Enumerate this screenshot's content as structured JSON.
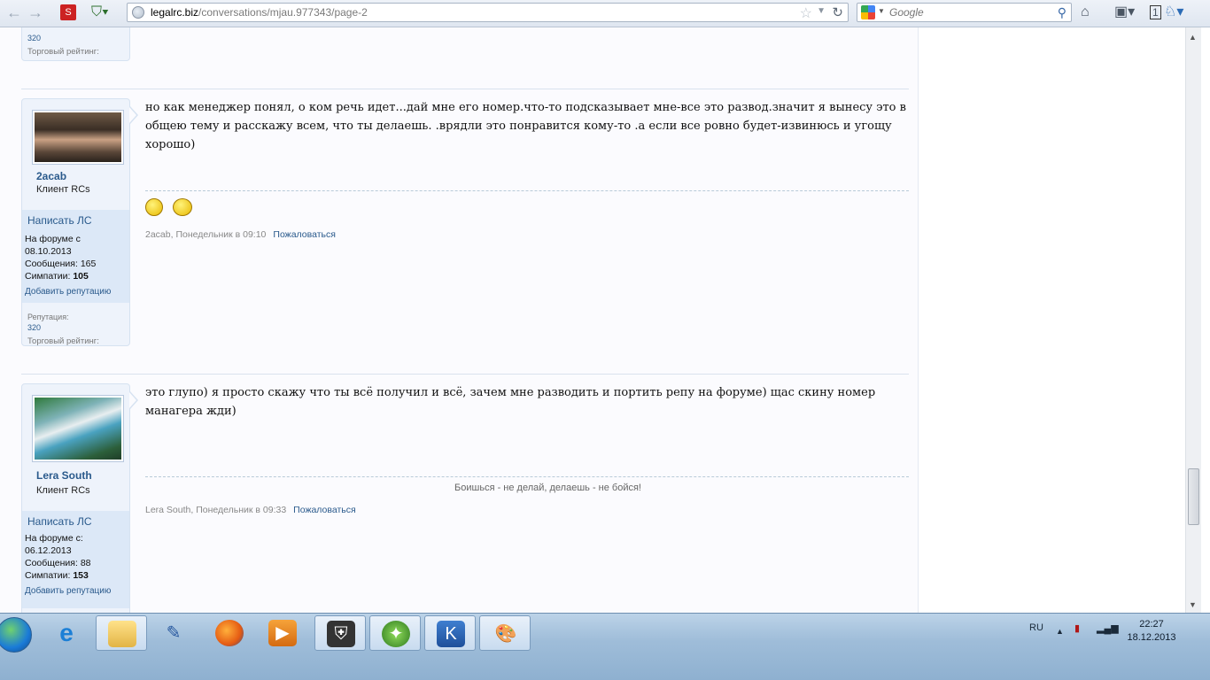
{
  "browser": {
    "url_host": "legalrc.biz",
    "url_path": "/conversations/mjau.977343/page-2",
    "search_placeholder": "Google",
    "tab_counter": "1"
  },
  "post_prev": {
    "rep_value": "320",
    "trade_label": "Торговый рейтинг:"
  },
  "posts": [
    {
      "username": "2acab",
      "user_title": "Клиент RCs",
      "pm_label": "Написать ЛС",
      "joined_label": "На форуме с",
      "joined_date": "08.10.2013",
      "messages_label": "Сообщения:",
      "messages": "165",
      "likes_label": "Симпатии:",
      "likes": "105",
      "add_rep": "Добавить репутацию",
      "rep_label": "Репутация:",
      "rep_value": "320",
      "trade_label": "Торговый рейтинг:",
      "text": "но как менеджер понял, о ком речь идет...дай мне его номер.что-то подсказывает мне-все это развод.значит я вынесу это в общею тему и расскажу всем, что ты делаешь. .врядли это понравится кому-то .а если все ровно будет-извинюсь и угощу хорошо)",
      "meta": "2acab, Понедельник в 09:10",
      "report": "Пожаловаться"
    },
    {
      "username": "Lera South",
      "user_title": "Клиент RCs",
      "pm_label": "Написать ЛС",
      "joined_label": "На форуме с:",
      "joined_date": "06.12.2013",
      "messages_label": "Сообщения:",
      "messages": "88",
      "likes_label": "Симпатии:",
      "likes": "153",
      "add_rep": "Добавить репутацию",
      "text": "это глупо) я просто скажу что ты всё получил и всё, зачем мне разводить и портить репу на форуме) щас скину номер манагера жди)",
      "signature": "Боишься - не делай, делаешь - не бойся!",
      "meta": "Lera South, Понедельник в 09:33",
      "report": "Пожаловаться"
    }
  ],
  "taskbar": {
    "apps": [
      "start-button",
      "internet-explorer",
      "explorer",
      "user-tool",
      "firefox",
      "media-player",
      "shield-app",
      "radar-app",
      "security-app",
      "paint-app"
    ],
    "lang": "RU",
    "time": "22:27",
    "date": "18.12.2013"
  }
}
